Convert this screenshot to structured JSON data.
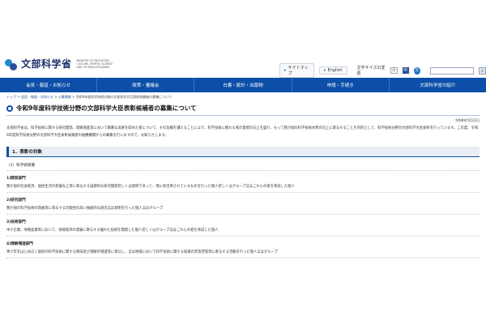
{
  "logo": {
    "title": "文部科学省",
    "subtitle": "MINISTRY OF EDUCATION, CULTURE, SPORTS, SCIENCE AND TECHNOLOGY-JAPAN"
  },
  "utility": {
    "sitemap": "サイトマップ",
    "english": "English",
    "font_size_label": "文字サイズの変更",
    "font_sizes": [
      "小",
      "中",
      "大"
    ]
  },
  "nav": {
    "items": [
      "会見・報道・お知らせ",
      "政策・審議会",
      "白書・統計・出版物",
      "申請・手続き",
      "文部科学省の紹介"
    ]
  },
  "breadcrumb": {
    "items": [
      "トップ",
      "会見・報道・お知らせ",
      "公募情報"
    ],
    "current": "令和9年度科学技術分野の文部科学大臣表彰候補者の募集について"
  },
  "page": {
    "title": "令和9年度科学技術分野の文部科学大臣表彰候補者の募集について",
    "date": "令和8年5月22日",
    "intro": "文部科学省は、科学技術に関する研究開発、理解増進等において顕著な成果を収めた者について、その功績を讃えることにより、科学技術に携わる者の意欲の向上を図り、もって我が国の科学技術水準の向上に寄与することを目的として、科学技術分野の文部科学大臣表彰を行っています。この度、令和9年度科学技術分野の文部科学大臣表彰候補者の推薦機関からの募集を行いますので、お知らせします。"
  },
  "section1": {
    "heading": "1．表彰の対象",
    "subheading": "（1）科学技術賞",
    "categories": [
      {
        "name": "1)開発部門",
        "desc": "我が国の社会経済、国民生活の発展向上等に寄与する画期的な研究開発若しくは発明であって、現に利活用されているものを行った個人若しくはグループ又はこれらの者を育成した個人"
      },
      {
        "name": "2)研究部門",
        "desc": "我が国の科学技術の発展等に寄与する可能性の高い独創的な研究又は発明を行った個人又はグループ"
      },
      {
        "name": "3)技術部門",
        "desc": "中小企業、地場産業等において、地域経済の発展に寄与する優れた技術を開発した個人若しくはグループ又はこれらの者を育成した個人"
      },
      {
        "name": "4)理解増進部門",
        "desc": "青少年をはじめ広く国民の科学技術に関する興味及び理解の増進等に寄与し、又は地域において科学技術に関する知識の普及啓発等に寄与する活動を行った個人又はグループ"
      }
    ]
  }
}
